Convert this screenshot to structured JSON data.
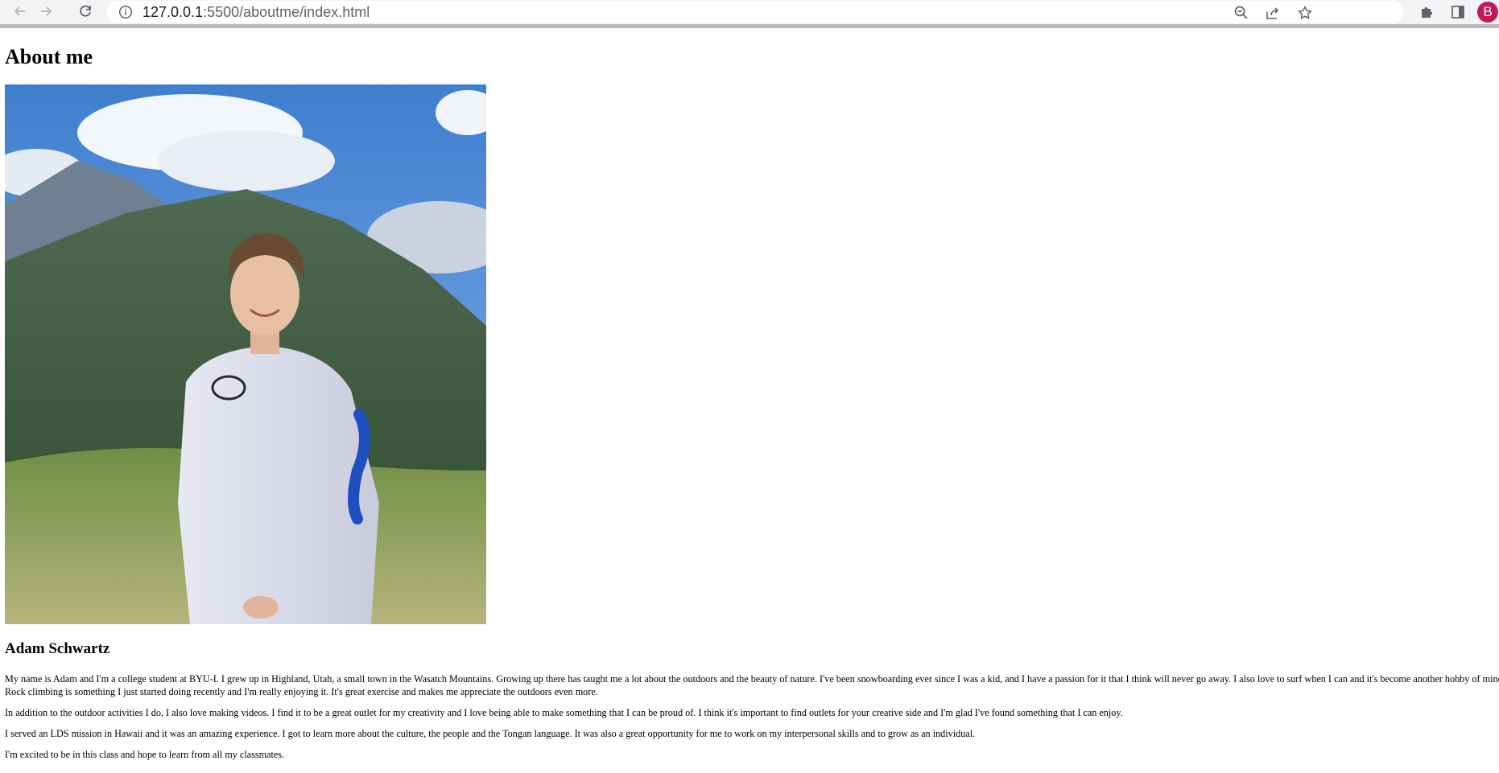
{
  "browser": {
    "url_host": "127.0.0.1",
    "url_rest": ":5500/aboutme/index.html",
    "profile_initial": "B",
    "icons": {
      "back": "back-arrow-icon",
      "forward": "forward-arrow-icon",
      "reload": "reload-icon",
      "site_info": "info-icon",
      "zoom": "zoom-out-icon",
      "share": "share-icon",
      "bookmark": "star-icon",
      "extensions": "puzzle-icon",
      "side_panel": "side-panel-icon"
    }
  },
  "page": {
    "title": "About me",
    "photo_description": "mountain-portrait-photo",
    "name": "Adam Schwartz",
    "paragraphs": [
      "My name is Adam and I'm a college student at BYU-I. I grew up in Highland, Utah, a small town in the Wasatch Mountains. Growing up there has taught me a lot about the outdoors and the beauty of nature. I've been snowboarding ever since I was a kid, and I have a passion for it that I think will never go away. I also love to surf when I can and it's become another hobby of mine. Rock climbing is something I just started doing recently and I'm really enjoying it. It's great exercise and makes me appreciate the outdoors even more.",
      "In addition to the outdoor activities I do, I also love making videos. I find it to be a great outlet for my creativity and I love being able to make something that I can be proud of. I think it's important to find outlets for your creative side and I'm glad I've found something that I can enjoy.",
      "I served an LDS mission in Hawaii and it was an amazing experience. I got to learn more about the culture, the people and the Tongan language. It was also a great opportunity for me to work on my interpersonal skills and to grow as an individual.",
      "I'm excited to be in this class and hope to learn from all my classmates."
    ]
  }
}
